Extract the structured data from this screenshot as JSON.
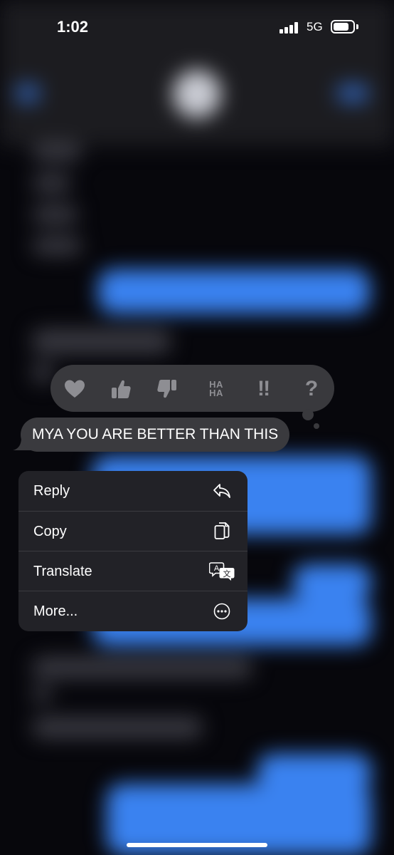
{
  "status_bar": {
    "time": "1:02",
    "network": "5G"
  },
  "tapbacks": [
    {
      "icon": "heart-icon"
    },
    {
      "icon": "thumbs-up-icon"
    },
    {
      "icon": "thumbs-down-icon"
    },
    {
      "icon": "haha-icon",
      "text": "HA HA"
    },
    {
      "icon": "exclamation-icon",
      "text": "‼"
    },
    {
      "icon": "question-icon",
      "text": "?"
    }
  ],
  "message": {
    "text": "MYA YOU ARE BETTER THAN THIS"
  },
  "menu": {
    "reply": "Reply",
    "copy": "Copy",
    "translate": "Translate",
    "more": "More..."
  },
  "colors": {
    "imessage_blue": "#3a82f0",
    "menu_bg": "#222227",
    "bubble_gray": "#3a3a3e"
  }
}
